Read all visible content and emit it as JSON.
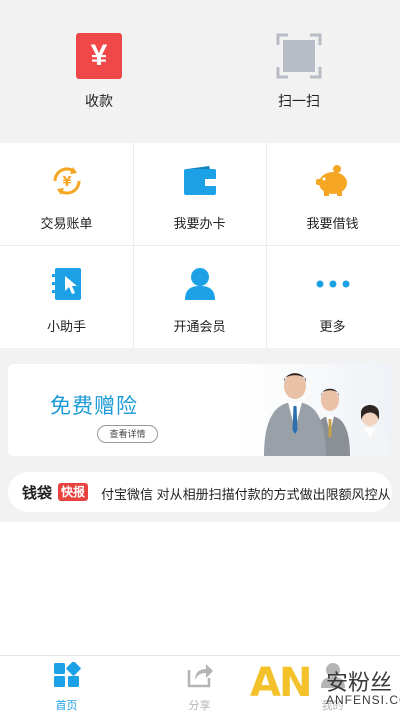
{
  "top_actions": [
    {
      "label": "收款",
      "symbol": "¥",
      "icon": "yen-icon",
      "color": "#f04848"
    },
    {
      "label": "扫一扫",
      "icon": "scan-icon",
      "color": "#b8bcc6"
    }
  ],
  "grid_items": [
    {
      "label": "交易账单",
      "icon": "bill-icon",
      "color": "#f5a623",
      "symbol": "¥"
    },
    {
      "label": "我要办卡",
      "icon": "wallet-icon",
      "color": "#1da1e6"
    },
    {
      "label": "我要借钱",
      "icon": "piggy-bank-icon",
      "color": "#f5a623"
    },
    {
      "label": "小助手",
      "icon": "notebook-icon",
      "color": "#1da1e6"
    },
    {
      "label": "开通会员",
      "icon": "user-icon",
      "color": "#1da1e6"
    },
    {
      "label": "更多",
      "icon": "more-icon",
      "color": "#1da1e6"
    }
  ],
  "banner": {
    "title": "免费赠险",
    "button_label": "查看详情",
    "image": "business-people-image"
  },
  "news": {
    "brand": "钱袋",
    "badge": "快报",
    "text": "付宝微信 对从相册扫描付款的方式做出限额风控从"
  },
  "tabbar": [
    {
      "label": "首页",
      "icon": "home-grid-icon",
      "active": true,
      "color": "#1da1e6"
    },
    {
      "label": "分享",
      "icon": "share-icon",
      "active": false,
      "color": "#b5b5b5"
    },
    {
      "label": "我的",
      "icon": "profile-icon",
      "active": false,
      "color": "#b5b5b5"
    }
  ],
  "watermark": {
    "logo": "AN",
    "name": "安粉丝",
    "site": "ANFENSI.COM"
  }
}
